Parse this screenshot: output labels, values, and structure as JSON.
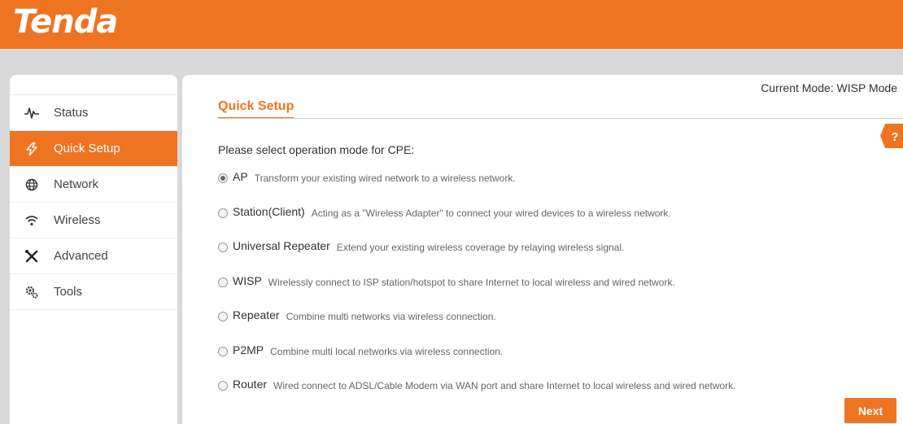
{
  "brand": {
    "logo_text": "Tenda",
    "accent_color": "#ef7421"
  },
  "sidebar": {
    "items": [
      {
        "label": "Status",
        "icon": "pulse-icon",
        "active": false
      },
      {
        "label": "Quick Setup",
        "icon": "lightning-icon",
        "active": true
      },
      {
        "label": "Network",
        "icon": "globe-icon",
        "active": false
      },
      {
        "label": "Wireless",
        "icon": "wifi-icon",
        "active": false
      },
      {
        "label": "Advanced",
        "icon": "tools-cross-icon",
        "active": false
      },
      {
        "label": "Tools",
        "icon": "gears-icon",
        "active": false
      }
    ]
  },
  "main": {
    "current_mode": "Current Mode: WISP Mode",
    "title": "Quick Setup",
    "help_icon": "?",
    "prompt": "Please select operation mode for CPE:",
    "options": [
      {
        "name": "AP",
        "description": "Transform your existing wired network to a wireless network.",
        "selected": true
      },
      {
        "name": "Station(Client)",
        "description": "Acting as a \"Wireless Adapter\" to connect your wired devices to a wireless network.",
        "selected": false
      },
      {
        "name": "Universal Repeater",
        "description": "Extend your existing wireless coverage by relaying wireless signal.",
        "selected": false
      },
      {
        "name": "WISP",
        "description": "Wirelessly connect to ISP station/hotspot to share Internet to local wireless and wired network.",
        "selected": false
      },
      {
        "name": "Repeater",
        "description": "Combine multi networks via wireless connection.",
        "selected": false
      },
      {
        "name": "P2MP",
        "description": "Combine multi local networks via wireless connection.",
        "selected": false
      },
      {
        "name": "Router",
        "description": "Wired connect to ADSL/Cable Modem via WAN port and share Internet to local wireless and wired network.",
        "selected": false
      }
    ],
    "next_label": "Next"
  }
}
